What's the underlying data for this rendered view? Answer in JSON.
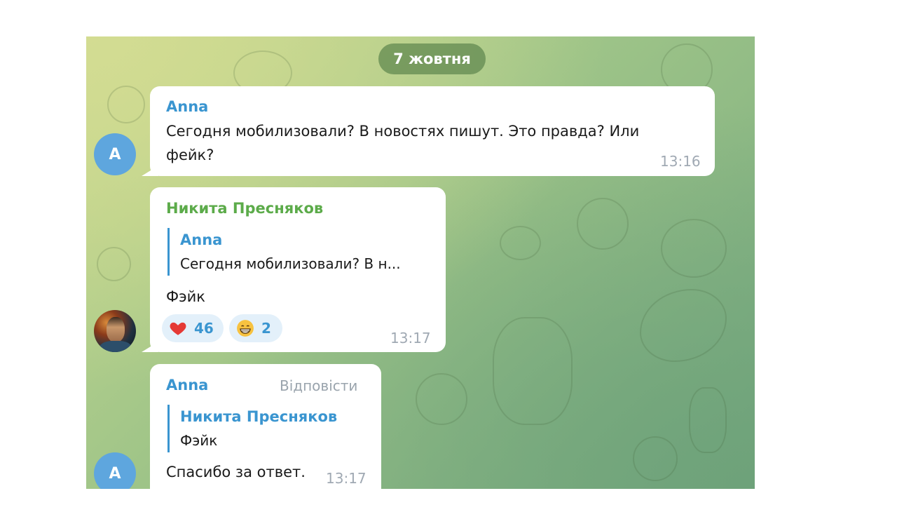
{
  "date_separator": "7 жовтня",
  "messages": [
    {
      "sender": "Anna",
      "avatar_letter": "A",
      "text_lines": [
        "Сегодня мобилизовали? В новостях пишут. Это правда? Или",
        "фейк?"
      ],
      "time": "13:16"
    },
    {
      "sender": "Никита Пресняков",
      "reply_to": {
        "name": "Anna",
        "text": "Сегодня мобилизовали? В н..."
      },
      "text": "Фэйк",
      "reactions": [
        {
          "emoji": "heart",
          "count": "46"
        },
        {
          "emoji": "grin",
          "count": "2"
        }
      ],
      "time": "13:17"
    },
    {
      "sender": "Anna",
      "avatar_letter": "A",
      "reply_action": "Відповісти",
      "reply_to": {
        "name": "Никита Пресняков",
        "text": "Фэйк"
      },
      "text": "Спасибо за ответ.",
      "time": "13:17"
    }
  ],
  "colors": {
    "accent_blue": "#3a95d0",
    "sender_green": "#5cab4a",
    "avatar_blue": "#5ea6de",
    "heart_red": "#e53935",
    "reaction_bg": "#e3f0fa"
  }
}
